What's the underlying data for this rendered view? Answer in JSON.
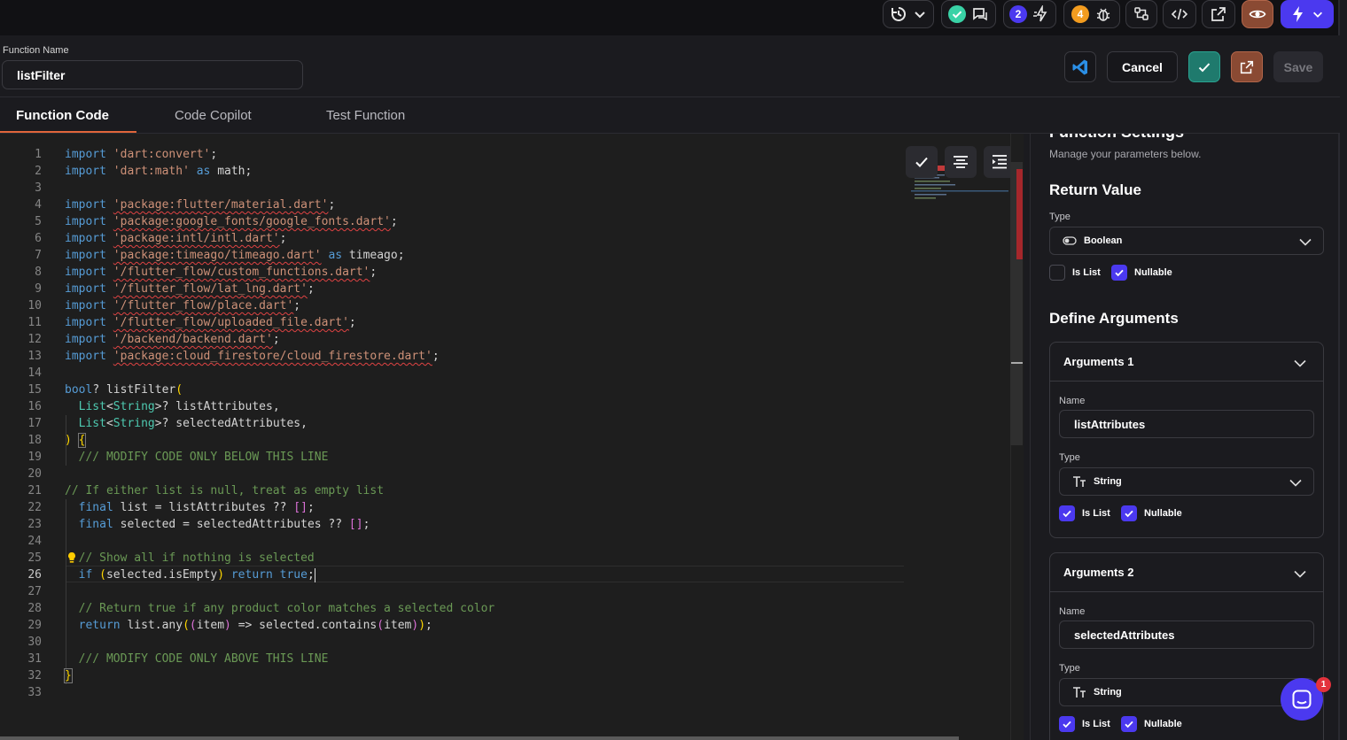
{
  "colors": {
    "accent": "#4B39EF",
    "tab_underline": "#E0653A",
    "success": "#249689",
    "warning": "#EE8B60",
    "error": "#E3323C"
  },
  "topbar": {
    "history_icon": "history-icon",
    "status_check_icon": "check-circle-icon",
    "comments_icon": "comments-icon",
    "notifications_count": "2",
    "warnings_count": "4"
  },
  "header": {
    "function_name_label": "Function Name",
    "function_name_value": "listFilter",
    "cancel_label": "Cancel",
    "save_label": "Save"
  },
  "tabs": [
    {
      "label": "Function Code"
    },
    {
      "label": "Code Copilot"
    },
    {
      "label": "Test Function"
    }
  ],
  "editor": {
    "current_line": "26",
    "lines": [
      "1",
      "2",
      "3",
      "4",
      "5",
      "6",
      "7",
      "8",
      "9",
      "10",
      "11",
      "12",
      "13",
      "14",
      "15",
      "16",
      "17",
      "18",
      "19",
      "20",
      "21",
      "22",
      "23",
      "24",
      "25",
      "26",
      "27",
      "28",
      "29",
      "30",
      "31",
      "32",
      "33"
    ],
    "code": {
      "l1a": "import",
      "l1b": "'dart:convert'",
      "l1c": ";",
      "l2a": "import",
      "l2b": "'dart:math'",
      "l2c": "as",
      "l2d": " math;",
      "l4a": "import",
      "l4b": "'package:flutter/material.dart'",
      "l4c": ";",
      "l5a": "import",
      "l5b": "'package:google_fonts/google_fonts.dart'",
      "l5c": ";",
      "l6a": "import",
      "l6b": "'package:intl/intl.dart'",
      "l6c": ";",
      "l7a": "import",
      "l7b": "'package:timeago/timeago.dart'",
      "l7c": "as",
      "l7d": " timeago;",
      "l8a": "import",
      "l8b": "'/flutter_flow/custom_functions.dart'",
      "l8c": ";",
      "l9a": "import",
      "l9b": "'/flutter_flow/lat_lng.dart'",
      "l9c": ";",
      "l10a": "import",
      "l10b": "'/flutter_flow/place.dart'",
      "l10c": ";",
      "l11a": "import",
      "l11b": "'/flutter_flow/uploaded_file.dart'",
      "l11c": ";",
      "l12a": "import",
      "l12b": "'/backend/backend.dart'",
      "l12c": ";",
      "l13a": "import",
      "l13b": "'package:cloud_firestore/cloud_firestore.dart'",
      "l13c": ";",
      "l15a": "bool",
      "l15b": "? listFilter",
      "l15c": "(",
      "l16a": "List",
      "l16b": "<",
      "l16c": "String",
      "l16d": ">? listAttributes,",
      "l17a": "List",
      "l17b": "<",
      "l17c": "String",
      "l17d": ">? selectedAttributes,",
      "l18a": ")",
      "l18b": " ",
      "l18c": "{",
      "l19": "/// MODIFY CODE ONLY BELOW THIS LINE",
      "l21": "// If either list is null, treat as empty list",
      "l22a": "final",
      "l22b": " list = listAttributes ?? ",
      "l22c": "[]",
      "l22d": ";",
      "l23a": "final",
      "l23b": " selected = selectedAttributes ?? ",
      "l23c": "[]",
      "l23d": ";",
      "l25": "// Show all if nothing is selected",
      "l26a": "if",
      "l26b": " ",
      "l26c": "(",
      "l26d": "selected.isEmpty",
      "l26e": ")",
      "l26f": " ",
      "l26g": "return",
      "l26h": " ",
      "l26i": "true",
      "l26j": ";",
      "l28": "// Return true if any product color matches a selected color",
      "l29a": "return",
      "l29b": " list.any",
      "l29c": "(",
      "l29d": "(",
      "l29e": "item",
      "l29f": ")",
      "l29g": " => selected.contains",
      "l29h": "(",
      "l29i": "item",
      "l29j": ")",
      "l29k": ")",
      "l29l": ";",
      "l31": "/// MODIFY CODE ONLY ABOVE THIS LINE",
      "l32": "}"
    }
  },
  "panel": {
    "title": "Function Settings",
    "subtitle": "Manage your parameters below.",
    "return_value_heading": "Return Value",
    "type_label": "Type",
    "return_type": "Boolean",
    "is_list_label": "Is List",
    "nullable_label": "Nullable",
    "return_is_list": false,
    "return_nullable": true,
    "define_arguments_heading": "Define Arguments",
    "arguments": [
      {
        "title": "Arguments 1",
        "name_label": "Name",
        "name": "listAttributes",
        "type_label": "Type",
        "type": "String",
        "is_list": true,
        "nullable": true
      },
      {
        "title": "Arguments 2",
        "name_label": "Name",
        "name": "selectedAttributes",
        "type_label": "Type",
        "type": "String",
        "is_list": true,
        "nullable": true
      }
    ]
  },
  "chat": {
    "unread": "1"
  }
}
